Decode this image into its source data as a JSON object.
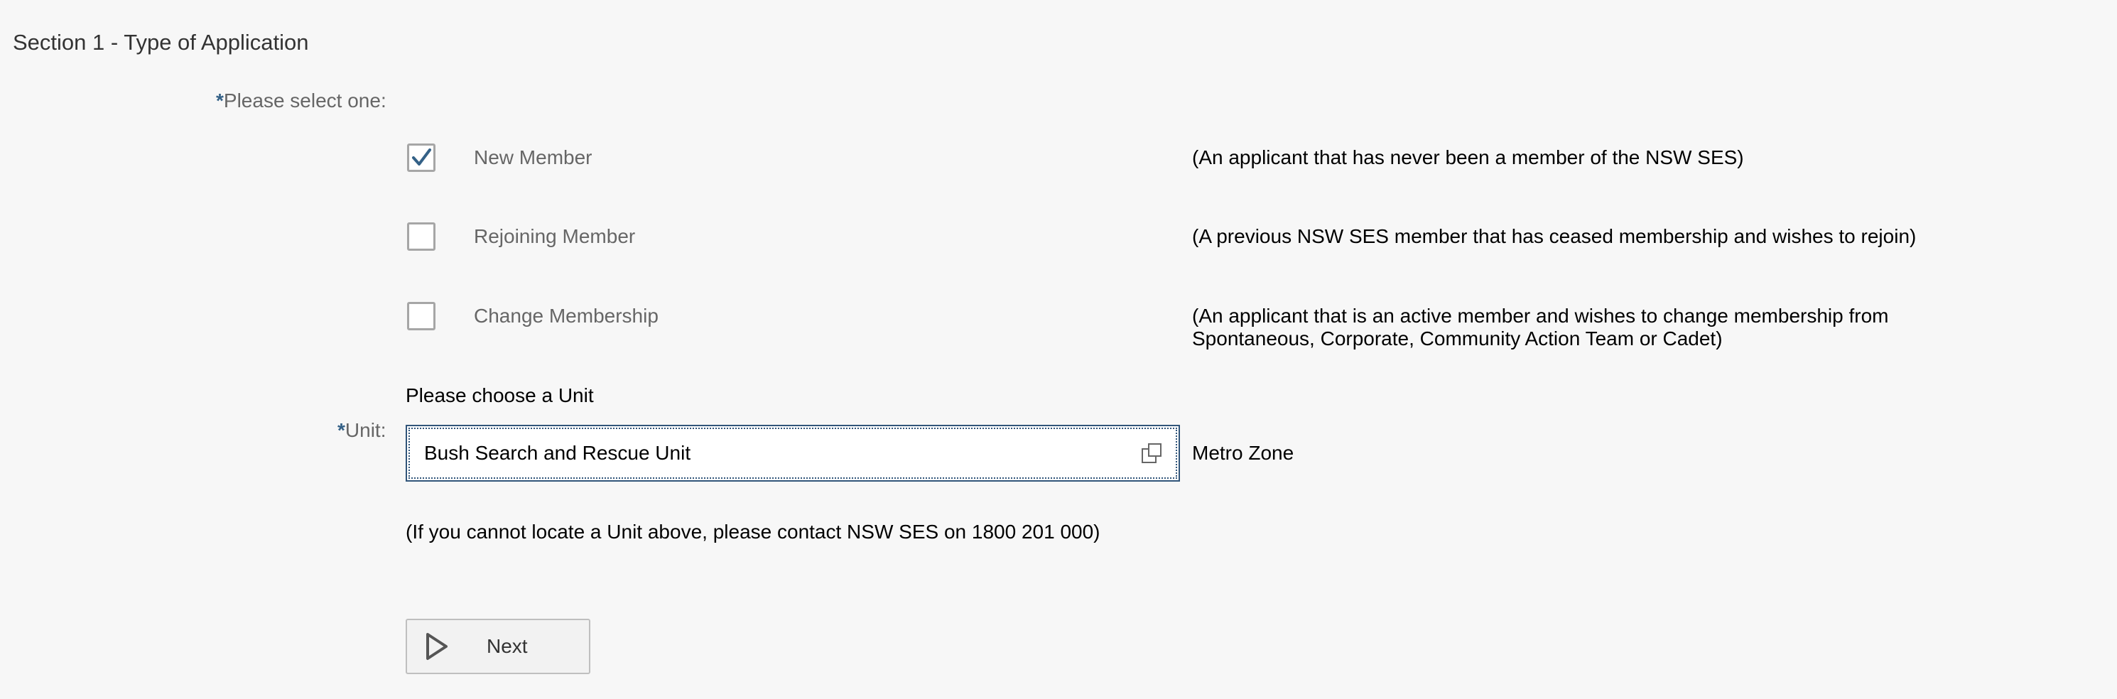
{
  "section": {
    "title": "Section 1 - Type of Application"
  },
  "selection": {
    "required_marker": "*",
    "label": "Please select one:",
    "options": [
      {
        "label": "New Member",
        "checked": true,
        "description": "(An applicant that has never been a member of the NSW SES)"
      },
      {
        "label": "Rejoining Member",
        "checked": false,
        "description": "(A previous NSW SES member that has ceased membership and wishes to rejoin)"
      },
      {
        "label": "Change Membership",
        "checked": false,
        "description": "(An applicant that is an active member and wishes to change membership from Spontaneous, Corporate, Community Action Team or Cadet)"
      }
    ]
  },
  "unit": {
    "prompt": "Please choose a Unit",
    "required_marker": "*",
    "label": "Unit:",
    "value": "Bush Search and Rescue Unit",
    "zone": "Metro Zone",
    "help_text": "(If you cannot locate a Unit above, please contact NSW SES on 1800 201 000)",
    "value_help_icon": "value-help-icon"
  },
  "actions": {
    "next_label": "Next",
    "next_icon": "play-triangle-icon"
  },
  "colors": {
    "background": "#f7f7f7",
    "required_star": "#346187",
    "checkmark": "#346187",
    "focus_border": "#31557a"
  }
}
